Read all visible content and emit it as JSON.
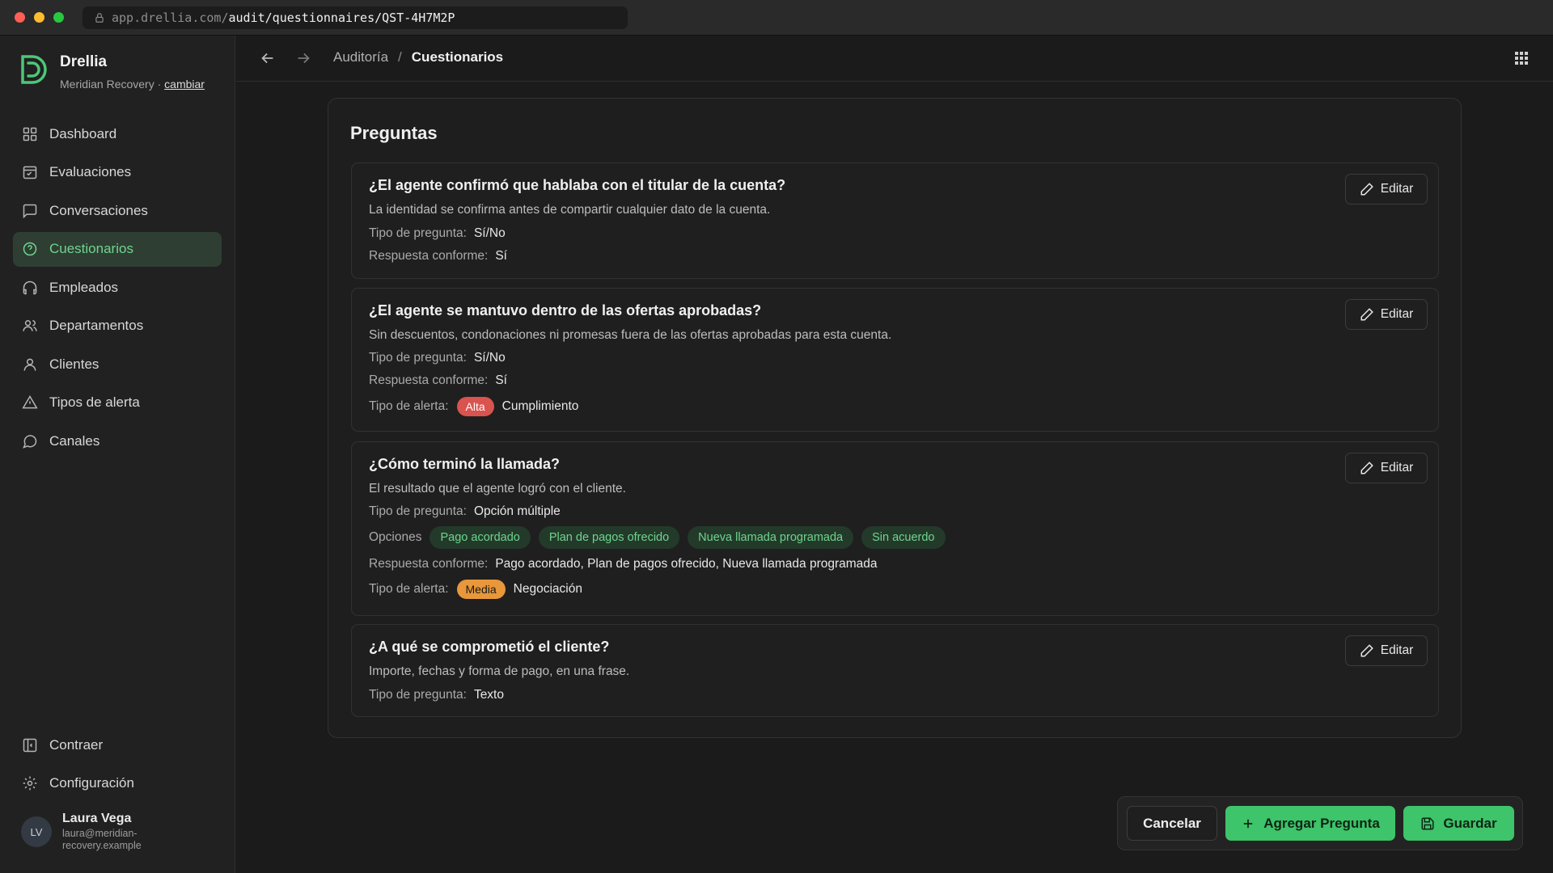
{
  "browser": {
    "url_host": "app.drellia.com/",
    "url_path": "audit/questionnaires/QST-4H7M2P"
  },
  "sidebar": {
    "brand_name": "Drellia",
    "org_name": "Meridian Recovery",
    "org_separator": "·",
    "change_label": "cambiar",
    "items": [
      {
        "label": "Dashboard",
        "icon": "grid-icon"
      },
      {
        "label": "Evaluaciones",
        "icon": "clipboard-icon"
      },
      {
        "label": "Conversaciones",
        "icon": "message-square-icon"
      },
      {
        "label": "Cuestionarios",
        "icon": "help-circle-icon",
        "active": true
      },
      {
        "label": "Empleados",
        "icon": "headphones-icon"
      },
      {
        "label": "Departamentos",
        "icon": "users-icon"
      },
      {
        "label": "Clientes",
        "icon": "user-icon"
      },
      {
        "label": "Tipos de alerta",
        "icon": "alert-triangle-icon"
      },
      {
        "label": "Canales",
        "icon": "message-circle-icon"
      }
    ],
    "collapse_label": "Contraer",
    "settings_label": "Configuración",
    "user": {
      "initials": "LV",
      "name": "Laura Vega",
      "email": "laura@meridian-recovery.example"
    }
  },
  "topbar": {
    "breadcrumb_parent": "Auditoría",
    "breadcrumb_separator": "/",
    "breadcrumb_current": "Cuestionarios"
  },
  "panel": {
    "title": "Preguntas",
    "labels": {
      "question_type": "Tipo de pregunta:",
      "compliant_answer": "Respuesta conforme:",
      "alert_type": "Tipo de alerta:",
      "options": "Opciones",
      "edit": "Editar"
    },
    "questions": [
      {
        "title": "¿El agente confirmó que hablaba con el titular de la cuenta?",
        "description": "La identidad se confirma antes de compartir cualquier dato de la cuenta.",
        "type": "Sí/No",
        "compliant": "Sí"
      },
      {
        "title": "¿El agente se mantuvo dentro de las ofertas aprobadas?",
        "description": "Sin descuentos, condonaciones ni promesas fuera de las ofertas aprobadas para esta cuenta.",
        "type": "Sí/No",
        "compliant": "Sí",
        "alert_level": "Alta",
        "alert_name": "Cumplimiento"
      },
      {
        "title": "¿Cómo terminó la llamada?",
        "description": "El resultado que el agente logró con el cliente.",
        "type": "Opción múltiple",
        "options": [
          "Pago acordado",
          "Plan de pagos ofrecido",
          "Nueva llamada programada",
          "Sin acuerdo"
        ],
        "compliant": "Pago acordado, Plan de pagos ofrecido, Nueva llamada programada",
        "alert_level": "Media",
        "alert_name": "Negociación"
      },
      {
        "title": "¿A qué se comprometió el cliente?",
        "description": "Importe, fechas y forma de pago, en una frase.",
        "type": "Texto"
      }
    ]
  },
  "actions": {
    "cancel": "Cancelar",
    "add_question": "Agregar Pregunta",
    "save": "Guardar"
  },
  "colors": {
    "accent": "#3ec46a",
    "accent_text": "#6fd48e",
    "alert_high": "#d9534f",
    "alert_medium": "#e8973a"
  }
}
